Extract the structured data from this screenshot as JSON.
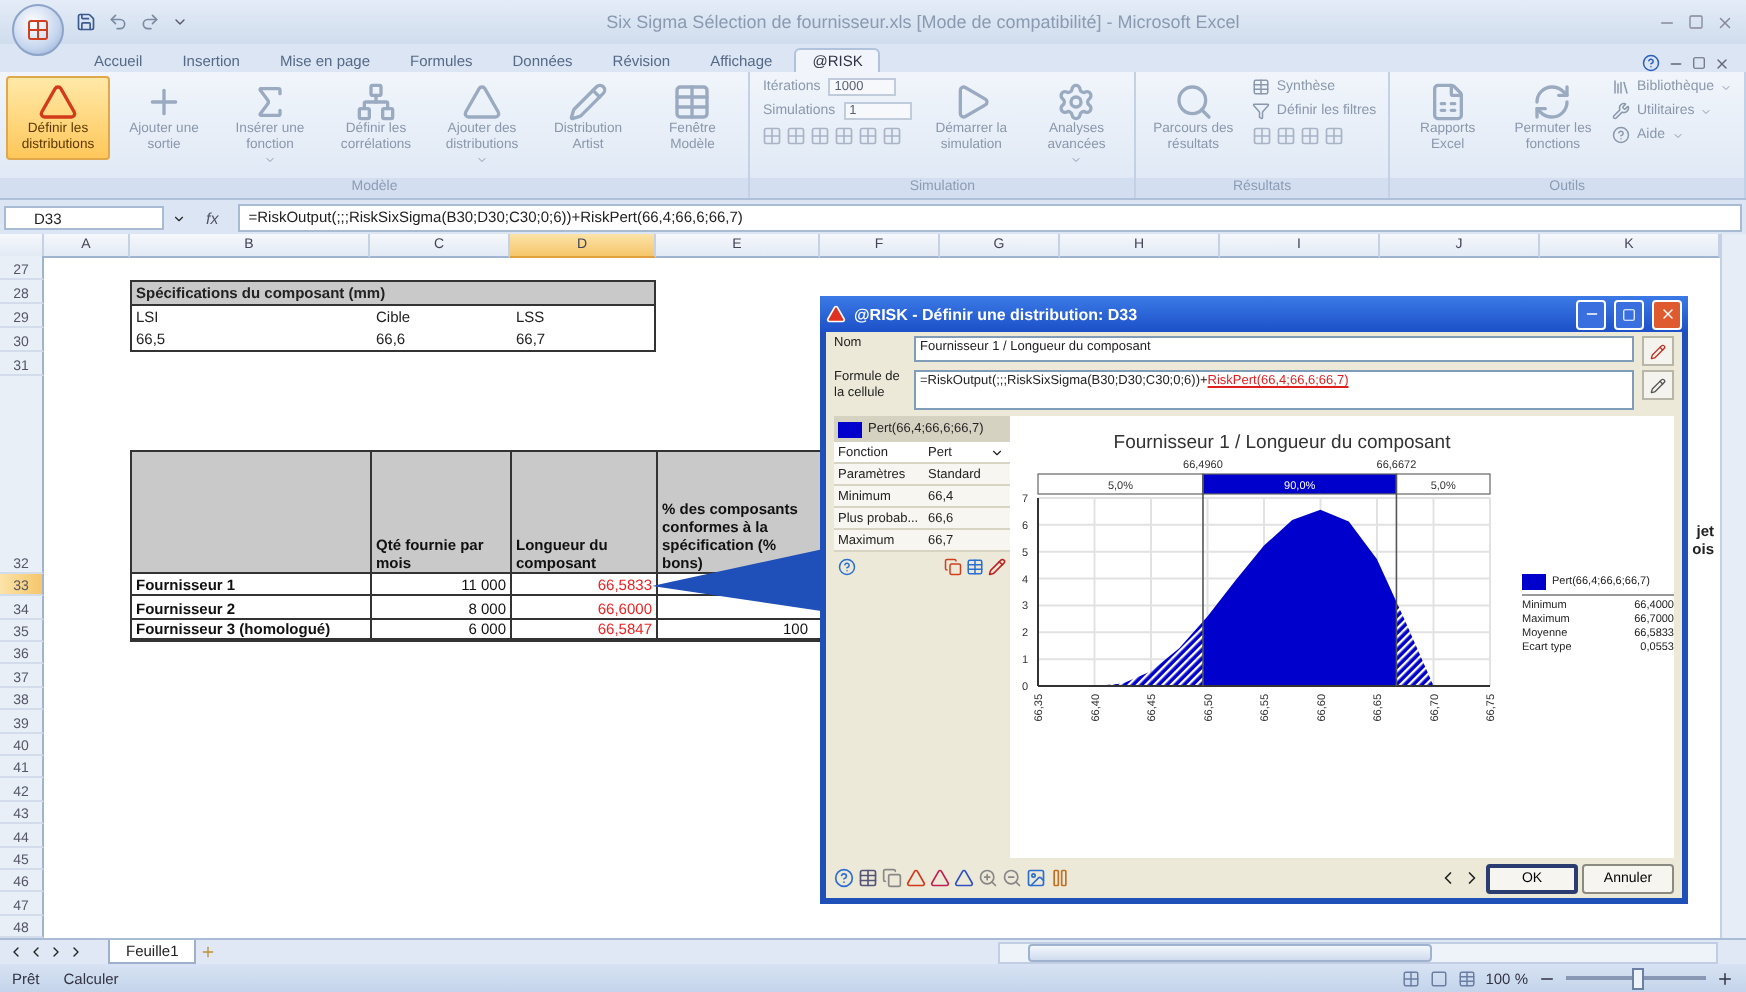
{
  "window": {
    "title": "Six Sigma Sélection de fournisseur.xls  [Mode de compatibilité] - Microsoft Excel"
  },
  "ribbon_tabs": [
    {
      "label": "Accueil",
      "selected": false
    },
    {
      "label": "Insertion",
      "selected": false
    },
    {
      "label": "Mise en page",
      "selected": false
    },
    {
      "label": "Formules",
      "selected": false
    },
    {
      "label": "Données",
      "selected": false
    },
    {
      "label": "Révision",
      "selected": false
    },
    {
      "label": "Affichage",
      "selected": false
    },
    {
      "label": "@RISK",
      "selected": true
    }
  ],
  "ribbon_groups": [
    {
      "label": "Modèle",
      "items": [
        {
          "kind": "large",
          "label": "Définir les distributions",
          "highlighted": true,
          "dropdown": false
        },
        {
          "kind": "large",
          "label": "Ajouter une sortie",
          "highlighted": false,
          "dropdown": false
        },
        {
          "kind": "large",
          "label": "Insérer une fonction",
          "highlighted": false,
          "dropdown": true
        },
        {
          "kind": "large",
          "label": "Définir les corrélations",
          "highlighted": false,
          "dropdown": false
        },
        {
          "kind": "large",
          "label": "Ajouter des distributions",
          "highlighted": false,
          "dropdown": true
        },
        {
          "kind": "large",
          "label": "Distribution Artist",
          "highlighted": false,
          "dropdown": false
        },
        {
          "kind": "large",
          "label": "Fenêtre Modèle",
          "highlighted": false,
          "dropdown": false
        }
      ]
    },
    {
      "label": "Simulation",
      "items": [
        {
          "kind": "stack",
          "items": [
            {
              "kind": "combo",
              "label": "Itérations",
              "value": "1000"
            },
            {
              "kind": "combo",
              "label": "Simulations",
              "value": "1"
            },
            {
              "kind": "icons"
            }
          ]
        },
        {
          "kind": "large",
          "label": "Démarrer la simulation",
          "highlighted": false,
          "dropdown": false
        },
        {
          "kind": "large",
          "label": "Analyses avancées",
          "highlighted": false,
          "dropdown": true
        }
      ]
    },
    {
      "label": "Résultats",
      "items": [
        {
          "kind": "large",
          "label": "Parcours des résultats",
          "highlighted": false,
          "dropdown": false
        },
        {
          "kind": "stack",
          "items": [
            {
              "kind": "small",
              "label": "Synthèse",
              "dropdown": false
            },
            {
              "kind": "small",
              "label": "Définir les filtres",
              "dropdown": false
            },
            {
              "kind": "icons"
            }
          ]
        }
      ]
    },
    {
      "label": "Outils",
      "items": [
        {
          "kind": "large",
          "label": "Rapports Excel",
          "highlighted": false,
          "dropdown": false
        },
        {
          "kind": "large",
          "label": "Permuter les fonctions",
          "highlighted": false,
          "dropdown": false
        },
        {
          "kind": "stack",
          "items": [
            {
              "kind": "small",
              "label": "Bibliothèque",
              "dropdown": true
            },
            {
              "kind": "small",
              "label": "Utilitaires",
              "dropdown": true
            },
            {
              "kind": "small",
              "label": "Aide",
              "dropdown": true
            }
          ]
        }
      ]
    }
  ],
  "formula_bar": {
    "cell": "D33",
    "fx_label": "fx",
    "formula": "=RiskOutput(;;;RiskSixSigma(B30;D30;C30;0;6))+RiskPert(66,4;66,6;66,7)"
  },
  "sheet": {
    "columns": [
      {
        "label": "A",
        "selected": false
      },
      {
        "label": "B",
        "selected": false
      },
      {
        "label": "C",
        "selected": false
      },
      {
        "label": "D",
        "selected": true
      },
      {
        "label": "E",
        "selected": false
      },
      {
        "label": "F",
        "selected": false
      },
      {
        "label": "G",
        "selected": false
      },
      {
        "label": "H",
        "selected": false
      },
      {
        "label": "I",
        "selected": false
      },
      {
        "label": "J",
        "selected": false
      },
      {
        "label": "K",
        "selected": false
      }
    ],
    "rows": [
      {
        "number": "27",
        "selected": false
      },
      {
        "number": "28",
        "selected": false
      },
      {
        "number": "29",
        "selected": false
      },
      {
        "number": "30",
        "selected": false
      },
      {
        "number": "31",
        "selected": false
      },
      {
        "number": "32",
        "selected": false
      },
      {
        "number": "33",
        "selected": true
      },
      {
        "number": "34",
        "selected": false
      },
      {
        "number": "35",
        "selected": false
      },
      {
        "number": "36",
        "selected": false
      },
      {
        "number": "37",
        "selected": false
      },
      {
        "number": "38",
        "selected": false
      },
      {
        "number": "39",
        "selected": false
      },
      {
        "number": "40",
        "selected": false
      },
      {
        "number": "41",
        "selected": false
      },
      {
        "number": "42",
        "selected": false
      },
      {
        "number": "43",
        "selected": false
      },
      {
        "number": "44",
        "selected": false
      },
      {
        "number": "45",
        "selected": false
      },
      {
        "number": "46",
        "selected": false
      },
      {
        "number": "47",
        "selected": false
      },
      {
        "number": "48",
        "selected": false
      }
    ],
    "spec_table": {
      "title": "Spécifications du composant (mm)",
      "headers": [
        "LSI",
        "Cible",
        "LSS"
      ],
      "values": [
        "66,5",
        "66,6",
        "66,7"
      ]
    },
    "supplier_table": {
      "headers": [
        "Qté fournie par mois",
        "Longueur du composant",
        "% des composants conformes à la spécification (% bons)"
      ],
      "cut_header_lines": [
        "jet",
        "ois"
      ],
      "rows": [
        {
          "name": "Fournisseur 1",
          "quantity": "11 000",
          "length": "66,5833"
        },
        {
          "name": "Fournisseur 2",
          "quantity": "8 000",
          "length": "66,6000"
        },
        {
          "name": "Fournisseur 3 (homologué)",
          "quantity": "6 000",
          "length": "66,5847",
          "conformity": "100"
        }
      ]
    }
  },
  "dialog": {
    "title": "@RISK - Définir une distribution: D33",
    "name_label": "Nom",
    "name_value": "Fournisseur 1 / Longueur du composant",
    "formula_label": "Formule de la cellule",
    "formula_plain": "=RiskOutput(;;;RiskSixSigma(B30;D30;C30;0;6))+",
    "formula_link": "RiskPert(66,4;66,6;66,7)",
    "function_header": "Pert(66,4;66,6;66,7)",
    "params": [
      {
        "kind": "dropdown",
        "label": "Fonction",
        "value": "Pert"
      },
      {
        "kind": "text",
        "label": "Paramètres",
        "value": "Standard"
      },
      {
        "kind": "text",
        "label": "Minimum",
        "value": "66,4"
      },
      {
        "kind": "text",
        "label": "Plus probab...",
        "value": "66,6"
      },
      {
        "kind": "text",
        "label": "Maximum",
        "value": "66,7"
      }
    ],
    "bands": [
      "5,0%",
      "90,0%",
      "5,0%"
    ],
    "chart_data": {
      "type": "area",
      "title": "Fournisseur 1 / Longueur du composant",
      "x": [
        66.35,
        66.375,
        66.4,
        66.425,
        66.45,
        66.475,
        66.5,
        66.525,
        66.55,
        66.575,
        66.6,
        66.625,
        66.65,
        66.675,
        66.7,
        66.725,
        66.75
      ],
      "series": [
        {
          "name": "Pert(66,4;66,6;66,7)",
          "color": "#0000cc",
          "values": [
            0,
            0,
            0,
            0.1,
            0.55,
            1.41,
            2.6,
            3.95,
            5.23,
            6.18,
            6.56,
            6.12,
            4.72,
            2.42,
            0,
            0,
            0
          ]
        }
      ],
      "xlim": [
        66.35,
        66.75
      ],
      "ylim": [
        0,
        7
      ],
      "xticks": [
        {
          "value": 66.35,
          "label": "66,35"
        },
        {
          "value": 66.4,
          "label": "66,40"
        },
        {
          "value": 66.45,
          "label": "66,45"
        },
        {
          "value": 66.5,
          "label": "66,50"
        },
        {
          "value": 66.55,
          "label": "66,55"
        },
        {
          "value": 66.6,
          "label": "66,60"
        },
        {
          "value": 66.65,
          "label": "66,65"
        },
        {
          "value": 66.7,
          "label": "66,70"
        },
        {
          "value": 66.75,
          "label": "66,75"
        }
      ],
      "yticks": [
        0,
        1,
        2,
        3,
        4,
        5,
        6,
        7
      ],
      "grid": true,
      "ref_lines": [
        {
          "axis": "x",
          "value": 66.496,
          "label": "66,4960"
        },
        {
          "axis": "x",
          "value": 66.6672,
          "label": "66,6672"
        }
      ]
    },
    "stats": [
      {
        "label": "Minimum",
        "value": "66,4000"
      },
      {
        "label": "Maximum",
        "value": "66,7000"
      },
      {
        "label": "Moyenne",
        "value": "66,5833"
      },
      {
        "label": "Ecart type",
        "value": "0,0553"
      }
    ],
    "buttons": [
      {
        "label": "OK",
        "default": true
      },
      {
        "label": "Annuler",
        "default": false
      }
    ]
  },
  "sheet_tabs": [
    {
      "label": "Feuille1",
      "selected": true
    }
  ],
  "status_bar": {
    "items": [
      "Prêt",
      "Calculer"
    ],
    "zoom": "100 %",
    "zoom_slider": {
      "level": 0.5
    }
  }
}
